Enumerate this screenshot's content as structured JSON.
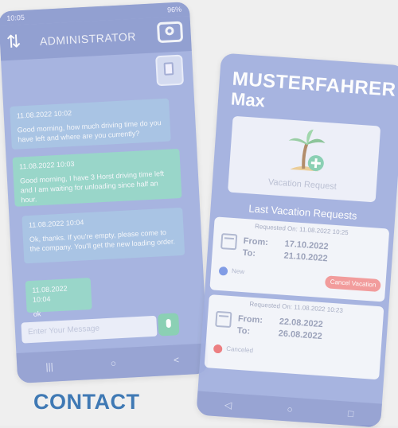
{
  "left_phone": {
    "status_time": "10:05",
    "status_right": "96%",
    "title": "ADMINISTRATOR",
    "messages": [
      {
        "time": "11.08.2022 10:02",
        "text": "Good morning, how much driving time do you have left and where are you currently?"
      },
      {
        "time": "11.08.2022 10:03",
        "text": "Good morning, I have 3 Horst driving time left and I am waiting for unloading since half an hour."
      },
      {
        "time": "11.08.2022 10:04",
        "text": "Ok, thanks. If you're empty, please come to the company. You'll get the new loading order."
      },
      {
        "time": "11.08.2022 10:04",
        "text": "ok"
      }
    ],
    "input_placeholder": "Enter Your Message",
    "nav": {
      "recent": "|||",
      "home": "○",
      "back": "<"
    }
  },
  "right_phone": {
    "status_time": "",
    "driver_last_name": "MUSTERFAHRER",
    "driver_first_name": "Max",
    "vacation_button_label": "Vacation Request",
    "section_title": "Last Vacation Requests",
    "requests": [
      {
        "requested_on": "Requested On: 11.08.2022 10:25",
        "from_label": "From:",
        "to_label": "To:",
        "from": "17.10.2022",
        "to": "21.10.2022",
        "status": "New",
        "status_color": "#5b7fe0",
        "cancel_label": "Cancel Vacation"
      },
      {
        "requested_on": "Requested On: 11.08.2022 10:23",
        "from_label": "From:",
        "to_label": "To:",
        "from": "22.08.2022",
        "to": "26.08.2022",
        "status": "Canceled",
        "status_color": "#e8585c"
      }
    ],
    "nav": {
      "back": "◁",
      "home": "○",
      "recent": "□"
    }
  },
  "page": {
    "heading": "CONTACT",
    "heading_color": "#3f79b4"
  }
}
